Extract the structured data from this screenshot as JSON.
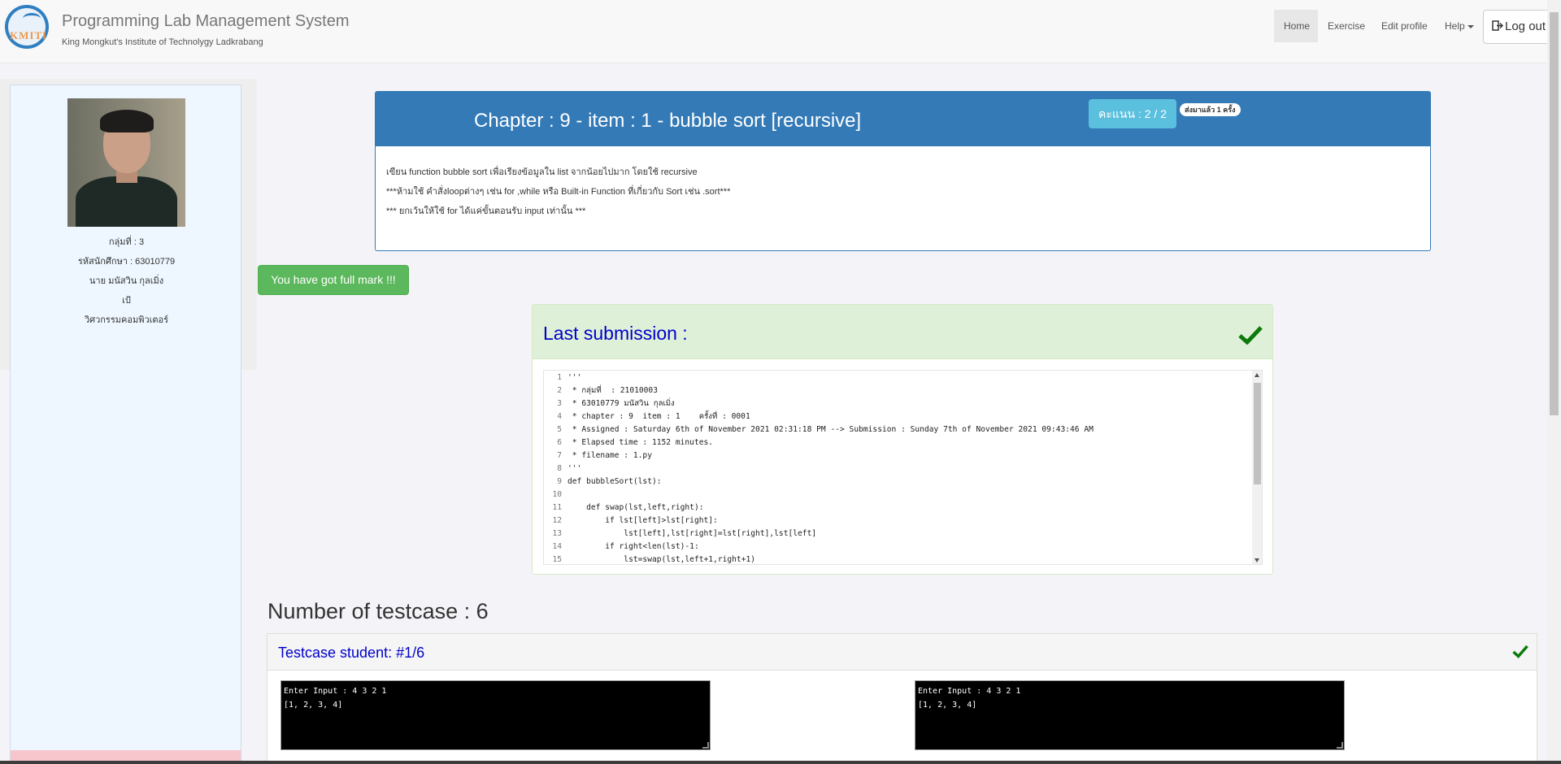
{
  "header": {
    "logo_text": "KMITL",
    "title": "Programming Lab Management System",
    "subtitle": "King Mongkut's Institute of Technolygy Ladkrabang",
    "nav": {
      "home": "Home",
      "exercise": "Exercise",
      "edit_profile": "Edit profile",
      "help": "Help",
      "logout": "Log out"
    }
  },
  "student": {
    "group": "กลุ่มที่ : 3",
    "student_id": "รหัสนักศึกษา : 63010779",
    "name": "นาย มนัสวิน กุลเมิ่ง",
    "nickname": "เป้",
    "department": "วิศวกรรมคอมพิวเตอร์"
  },
  "chapter": {
    "title": "Chapter : 9 - item : 1 - bubble sort [recursive]",
    "score": "คะแนน : 2 / 2",
    "sent_badge": "ส่งมาแล้ว 1 ครั้ง",
    "lines": [
      "เขียน function bubble sort เพื่อเรียงข้อมูลใน list จากน้อยไปมาก โดยใช้ recursive",
      "***ห้ามใช้ คำสั่งloopต่างๆ เช่น for ,while หรือ Built-in Function ที่เกี่ยวกับ Sort เช่น .sort***",
      "*** ยกเว้นให้ใช้  for ได้แค่ขั้นตอนรับ input เท่านั้น ***"
    ]
  },
  "full_mark_message": "You have got full mark !!!",
  "submission": {
    "title": "Last submission :",
    "code_lines": [
      {
        "n": "1",
        "text": "'''"
      },
      {
        "n": "2",
        "text": " * กลุ่มที่  : 21010003"
      },
      {
        "n": "3",
        "text": " * 63010779 มนัสวิน กุลเมิ่ง"
      },
      {
        "n": "4",
        "text": " * chapter : 9  item : 1    ครั้งที่ : 0001"
      },
      {
        "n": "5",
        "text": " * Assigned : Saturday 6th of November 2021 02:31:18 PM --> Submission : Sunday 7th of November 2021 09:43:46 AM"
      },
      {
        "n": "6",
        "text": " * Elapsed time : 1152 minutes."
      },
      {
        "n": "7",
        "text": " * filename : 1.py"
      },
      {
        "n": "8",
        "text": "'''"
      },
      {
        "n": "9",
        "text": "def bubbleSort(lst):"
      },
      {
        "n": "10",
        "text": ""
      },
      {
        "n": "11",
        "text": "    def swap(lst,left,right):"
      },
      {
        "n": "12",
        "text": "        if lst[left]>lst[right]:"
      },
      {
        "n": "13",
        "text": "            lst[left],lst[right]=lst[right],lst[left]"
      },
      {
        "n": "14",
        "text": "        if right<len(lst)-1:"
      },
      {
        "n": "15",
        "text": "            lst=swap(lst,left+1,right+1)"
      }
    ]
  },
  "testcases": {
    "count_label": "Number of testcase : 6",
    "first": {
      "title": "Testcase student: #1/6",
      "expected_output": "Enter Input : 4 3 2 1\n[1, 2, 3, 4]",
      "student_output": "Enter Input : 4 3 2 1\n[1, 2, 3, 4]"
    }
  },
  "colors": {
    "primary": "#337ab7",
    "success": "#5cb85c",
    "info": "#5bc0de",
    "link_blue": "#0000cc"
  }
}
